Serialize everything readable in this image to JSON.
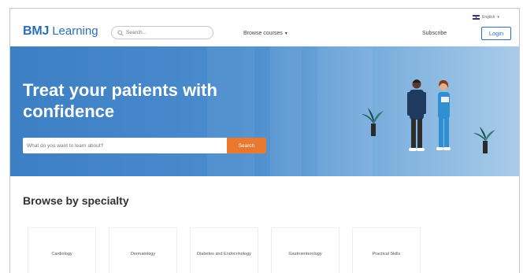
{
  "header": {
    "logo_bmj": "BMJ",
    "logo_learning": "Learning",
    "search_placeholder": "Search...",
    "browse_label": "Browse courses",
    "language": "English",
    "subscribe_label": "Subscribe",
    "login_label": "Login"
  },
  "hero": {
    "title": "Treat your patients with confidence",
    "search_placeholder": "What do you want to learn about?",
    "search_button": "Search"
  },
  "specialty": {
    "title": "Browse by specialty",
    "items": [
      {
        "label": "Cardiology"
      },
      {
        "label": "Dermatology"
      },
      {
        "label": "Diabetes and Endocrinology"
      },
      {
        "label": "Gastroenterology"
      },
      {
        "label": "Practical Skills"
      }
    ]
  },
  "colors": {
    "brand_blue": "#2a6ebb",
    "hero_blue": "#3d7fc4",
    "search_orange": "#e8792f"
  }
}
